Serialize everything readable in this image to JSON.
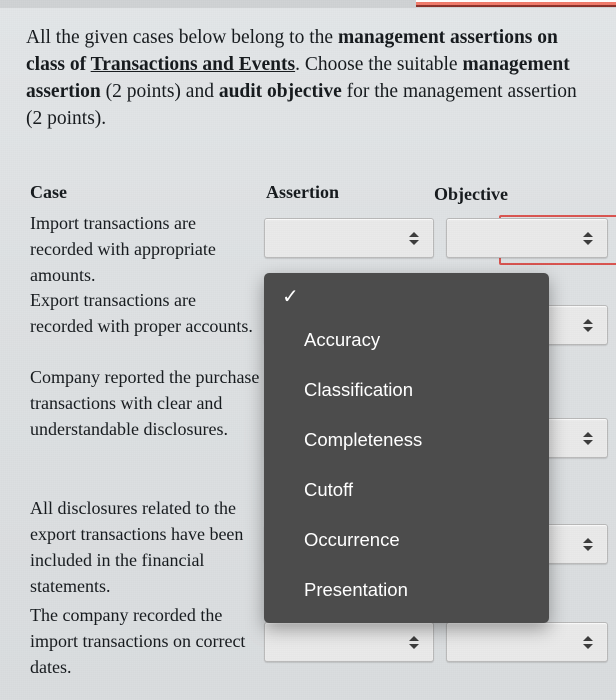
{
  "prompt": {
    "seg1": "All the given cases below belong to the ",
    "seg2": "management assertions on class of ",
    "seg3": "Transactions and Events",
    "seg4": ". Choose the suitable ",
    "seg5": "management assertion",
    "seg6": " (2 points) and ",
    "seg7": "audit objective",
    "seg8": " for the management assertion (2 points)."
  },
  "table": {
    "headers": {
      "case": "Case",
      "assertion": "Assertion",
      "objective": "Objective"
    },
    "rows": [
      {
        "case": "Import transactions are recorded with appropriate amounts.",
        "assertion_value": "",
        "objective_value": ""
      },
      {
        "case": "Export transactions are recorded with proper accounts.",
        "assertion_value": "",
        "objective_value": ""
      },
      {
        "case": "Company reported the purchase transactions with clear and understandable disclosures.",
        "assertion_value": "",
        "objective_value": ""
      },
      {
        "case": "All disclosures related to the export transactions have been included in the financial statements.",
        "assertion_value": "",
        "objective_value": ""
      },
      {
        "case": "The company recorded the import transactions on correct dates.",
        "assertion_value": "",
        "objective_value": ""
      }
    ]
  },
  "dropdown": {
    "selected": "",
    "check_glyph": "✓",
    "options": [
      {
        "label": "",
        "selected": true
      },
      {
        "label": "Accuracy",
        "selected": false
      },
      {
        "label": "Classification",
        "selected": false
      },
      {
        "label": "Completeness",
        "selected": false
      },
      {
        "label": "Cutoff",
        "selected": false
      },
      {
        "label": "Occurrence",
        "selected": false
      },
      {
        "label": "Presentation",
        "selected": false
      }
    ]
  },
  "colors": {
    "accent": "#f07a6a",
    "focus": "#d9534f",
    "dropdown_bg": "#4c4c4c",
    "page_bg": "#dfe2e4"
  }
}
